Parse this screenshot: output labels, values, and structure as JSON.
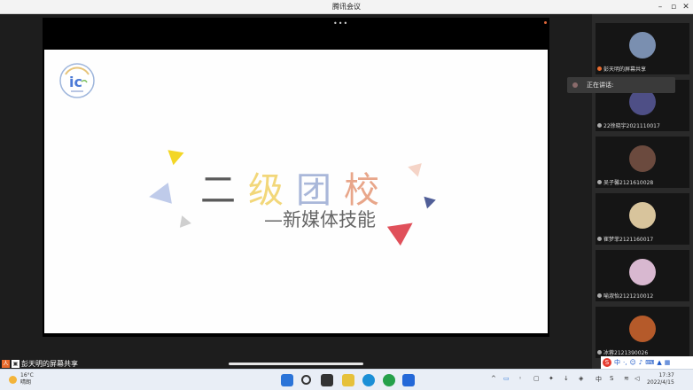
{
  "window": {
    "title": "腾讯会议",
    "minimize_icon": "minimize-icon",
    "maximize_icon": "maximize-icon",
    "close_icon": "close-icon"
  },
  "slide": {
    "title_chars": [
      "二",
      "级",
      "团",
      "校"
    ],
    "title_colors": [
      "#5a5a5a",
      "#f2d77a",
      "#a9b7d9",
      "#e8a68a"
    ],
    "subtitle": "—新媒体技能"
  },
  "share": {
    "label": "彭天明的屏幕共享"
  },
  "speaking": {
    "label": "正在讲话:"
  },
  "participants": [
    {
      "name": "彭天明的屏幕共享",
      "avatar_color": "#7a8fb0"
    },
    {
      "name": "22徐晓宇2021110017",
      "avatar_color": "#4e4f86"
    },
    {
      "name": "吴子馨2121610028",
      "avatar_color": "#6b4a3e"
    },
    {
      "name": "崔梦菲2121160017",
      "avatar_color": "#d8c49c"
    },
    {
      "name": "喻淑怡2121210012",
      "avatar_color": "#d8b8d0"
    },
    {
      "name": "冰蓉2121390026",
      "avatar_color": "#b55a2a"
    }
  ],
  "ime": {
    "mode": "中",
    "icon": "sogou-ime-icon"
  },
  "taskbar": {
    "temp": "16°C",
    "weather": "晴朗",
    "time": "17:37",
    "date": "2022/4/15",
    "lang": "中"
  }
}
